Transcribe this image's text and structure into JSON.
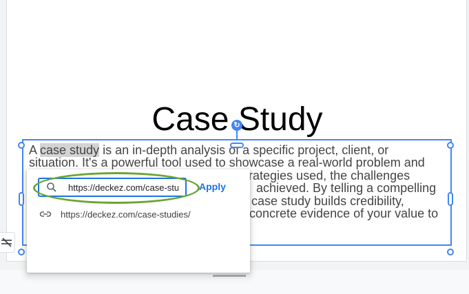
{
  "slide": {
    "title": "Case Study",
    "body": {
      "highlight": "case study",
      "prefix": "A ",
      "lines": [
        " is an in-depth analysis of a specific project, client, or",
        "situation. It's a powerful tool used to showcase a real-world problem and",
        "he strategies used, the challenges",
        "achieved. By telling a compelling",
        "case study builds credibility,",
        "concrete evidence of your value to"
      ]
    }
  },
  "link_popup": {
    "input_value": "https://deckez.com/case-studies/",
    "apply_label": "Apply",
    "suggestion": "https://deckez.com/case-studies/"
  },
  "colors": {
    "selection": "#4285f4",
    "accent": "#1a73e8",
    "annotation": "#6aa532",
    "highlight": "#d3d3d3"
  },
  "icons": {
    "search": "search-icon",
    "link": "link-icon",
    "rotate": "rotate-handle-icon",
    "tool": "format-clear-icon"
  }
}
